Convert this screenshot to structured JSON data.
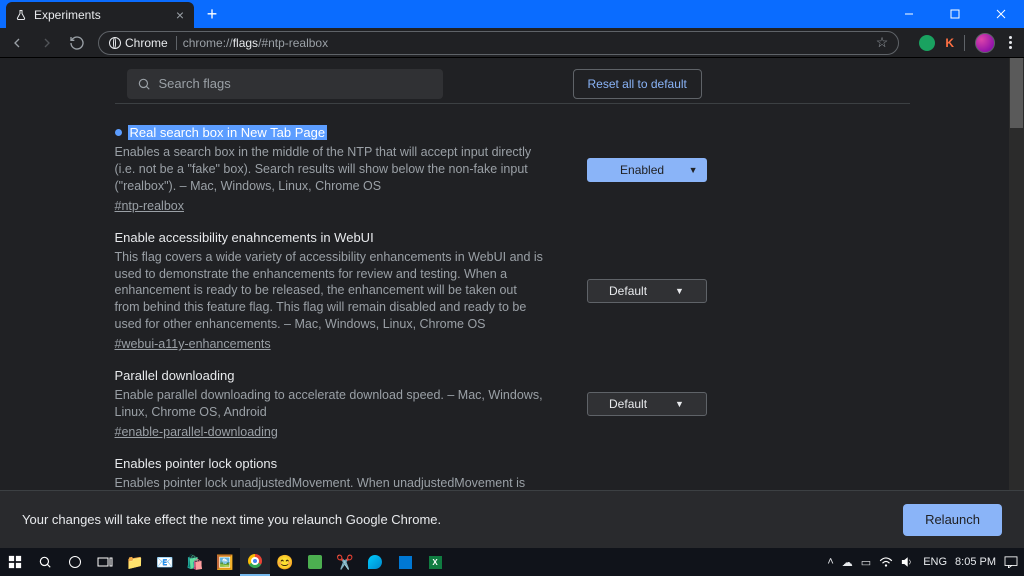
{
  "window": {
    "tab_title": "Experiments",
    "url_host": "Chrome",
    "url_path_hl": "flags",
    "url_rest": "/#ntp-realbox",
    "ext_letter": "K"
  },
  "search": {
    "placeholder": "Search flags"
  },
  "reset_label": "Reset all to default",
  "flags": [
    {
      "title": "Real search box in New Tab Page",
      "desc": "Enables a search box in the middle of the NTP that will accept input directly (i.e. not be a \"fake\" box). Search results will show below the non-fake input (\"realbox\"). – Mac, Windows, Linux, Chrome OS",
      "link": "#ntp-realbox",
      "select": "Enabled",
      "highlighted": true
    },
    {
      "title": "Enable accessibility enahncements in WebUI",
      "desc": "This flag covers a wide variety of accessibility enhancements in WebUI and is used to demonstrate the enhancements for review and testing. When a enhancement is ready to be released, the enhancement will be taken out from behind this feature flag. This flag will remain disabled and ready to be used for other enhancements. – Mac, Windows, Linux, Chrome OS",
      "link": "#webui-a11y-enhancements",
      "select": "Default"
    },
    {
      "title": "Parallel downloading",
      "desc": "Enable parallel downloading to accelerate download speed. – Mac, Windows, Linux, Chrome OS, Android",
      "link": "#enable-parallel-downloading",
      "select": "Default"
    },
    {
      "title": "Enables pointer lock options",
      "desc": "Enables pointer lock unadjustedMovement. When unadjustedMovement is set to true,",
      "link": "",
      "select": ""
    }
  ],
  "relaunch": {
    "msg": "Your changes will take effect the next time you relaunch Google Chrome.",
    "btn": "Relaunch"
  },
  "tray": {
    "lang": "ENG",
    "time": "8:05 PM",
    "date": ""
  }
}
